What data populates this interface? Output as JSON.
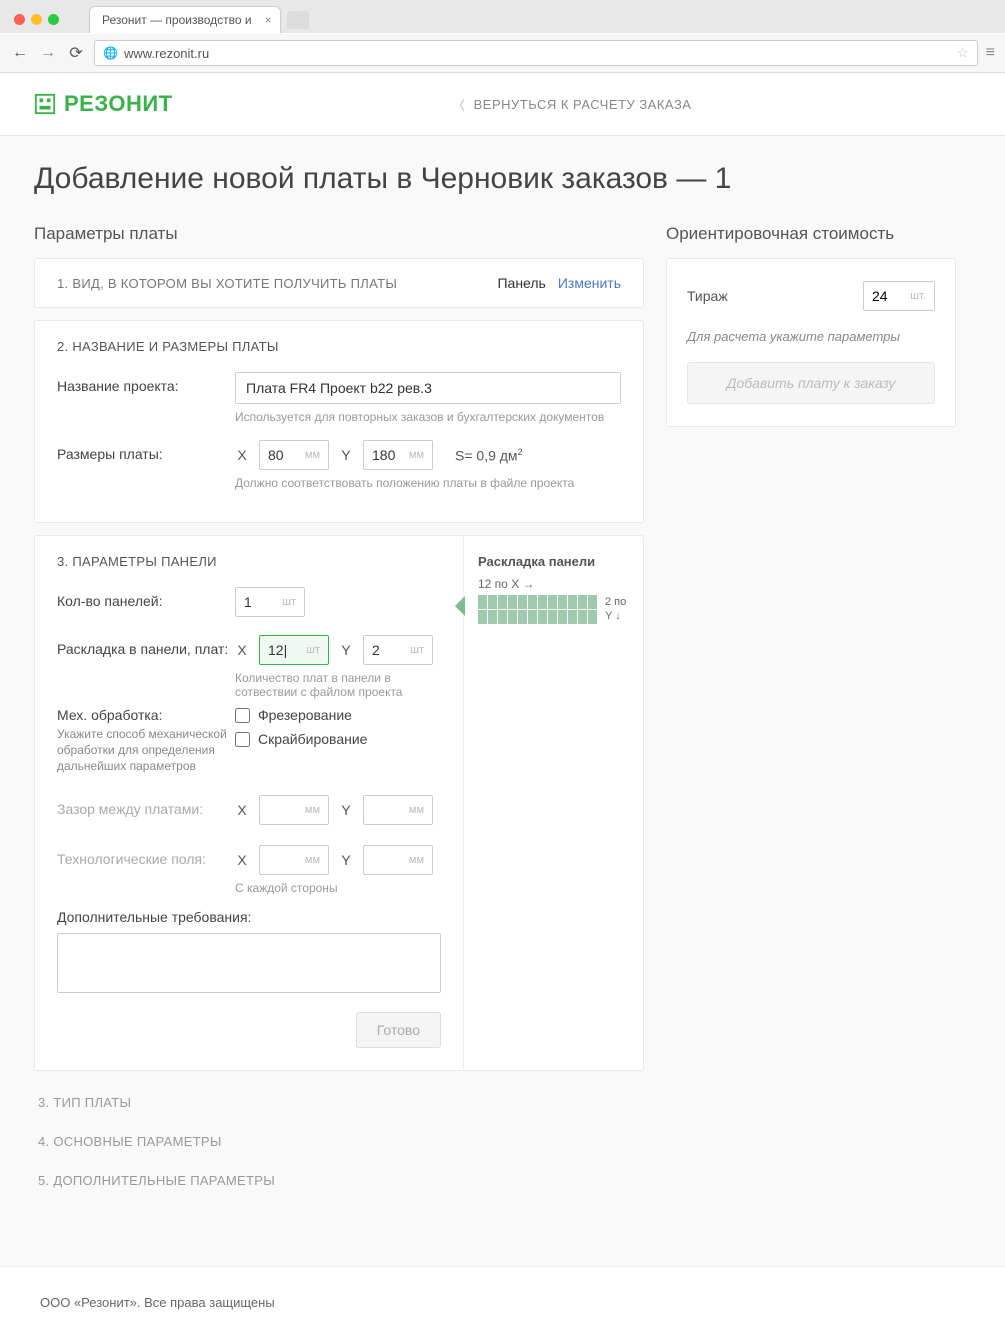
{
  "browser": {
    "tab_title": "Резонит — производство и",
    "url": "www.rezonit.ru"
  },
  "header": {
    "logo_text": "РЕЗОНИТ",
    "back_link": "ВЕРНУТЬСЯ К РАСЧЕТУ ЗАКАЗА"
  },
  "page_title": "Добавление новой платы в Черновик заказов — 1",
  "left_heading": "Параметры платы",
  "step1": {
    "title": "1. ВИД, В КОТОРОМ ВЫ ХОТИТЕ ПОЛУЧИТЬ ПЛАТЫ",
    "value": "Панель",
    "change": "Изменить"
  },
  "step2": {
    "title": "2. НАЗВАНИЕ И РАЗМЕРЫ ПЛАТЫ",
    "name_label": "Название проекта:",
    "name_value": "Плата FR4 Проект b22 рев.3",
    "name_hint": "Используется для повторных заказов и бухгалтерских документов",
    "size_label": "Размеры платы:",
    "x_label": "X",
    "x_value": "80",
    "y_label": "Y",
    "y_value": "180",
    "unit_mm": "мм",
    "area": "S= 0,9 дм",
    "area_sup": "2",
    "size_hint": "Должно соответствовать положению платы в файле проекта"
  },
  "step3": {
    "title": "3. ПАРАМЕТРЫ ПАНЕЛИ",
    "panels_label": "Кол-во панелей:",
    "panels_value": "1",
    "unit_sht": "шт",
    "layout_label": "Раскладка в панели, плат:",
    "layout_x": "12|",
    "layout_y": "2",
    "layout_hint": "Количество плат в панели в сотвествии с файлом проекта",
    "mech_label": "Мех. обработка:",
    "mech_sub": "Укажите способ механической обработки для определения дальнейших параметров",
    "cb_frez": "Фрезерование",
    "cb_skrb": "Скрайбирование",
    "gap_label": "Зазор между платами:",
    "tech_label": "Технологические поля:",
    "tech_hint": "С каждой стороны",
    "extra_label": "Дополнительные требования:",
    "btn_ready": "Готово",
    "preview_title": "Раскладка панели",
    "preview_x": "12 по X →",
    "preview_y": "2 по Y ↓"
  },
  "steps_rest": {
    "s3": "3. ТИП ПЛАТЫ",
    "s4": "4. ОСНОВНЫЕ ПАРАМЕТРЫ",
    "s5": "5. ДОПОЛНИТЕЛЬНЫЕ ПАРАМЕТРЫ"
  },
  "right": {
    "heading": "Ориентировочная стоимость",
    "tirazh_label": "Тираж",
    "tirazh_value": "24",
    "tirazh_unit": "шт.",
    "hint": "Для расчета укажите параметры",
    "btn_add": "Добавить плату к заказу"
  },
  "footer": "ООО «Резонит». Все права защищены"
}
